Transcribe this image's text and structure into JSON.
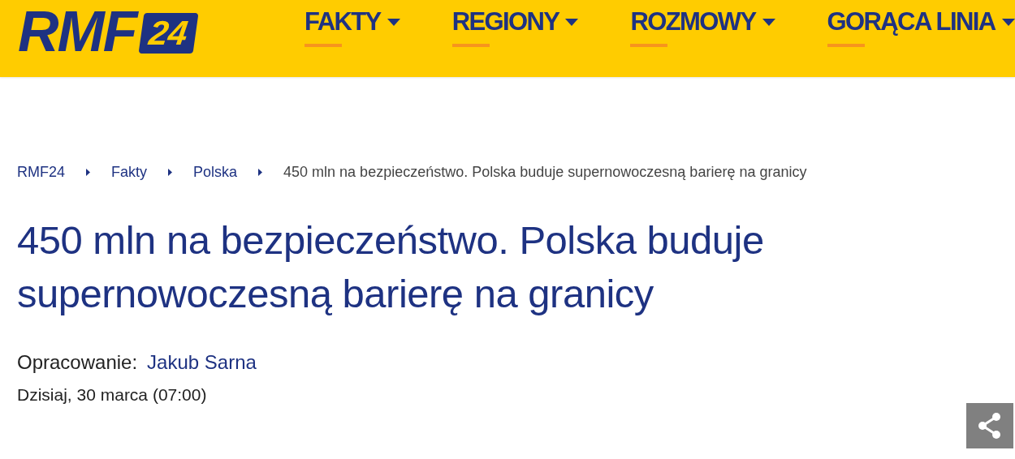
{
  "header": {
    "logo": {
      "text": "RMF",
      "badge": "24"
    },
    "nav": [
      {
        "label": "FAKTY"
      },
      {
        "label": "REGIONY"
      },
      {
        "label": "ROZMOWY"
      },
      {
        "label": "GORĄCA LINIA"
      }
    ]
  },
  "breadcrumb": [
    {
      "label": "RMF24",
      "kind": "link"
    },
    {
      "label": "Fakty",
      "kind": "link"
    },
    {
      "label": "Polska",
      "kind": "link"
    },
    {
      "label": "450 mln na bezpieczeństwo. Polska buduje supernowoczesną barierę na granicy",
      "kind": "current"
    }
  ],
  "article": {
    "title": "450 mln na bezpieczeństwo. Polska buduje supernowoczesną barierę na granicy",
    "author_label": "Opracowanie:",
    "author": "Jakub Sarna",
    "date": "Dzisiaj, 30 marca (07:00)"
  }
}
